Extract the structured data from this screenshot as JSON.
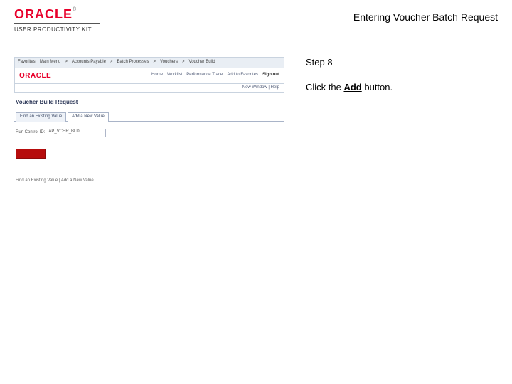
{
  "header": {
    "logo_text": "ORACLE",
    "tm": "®",
    "upk": "USER PRODUCTIVITY KIT",
    "title": "Entering Voucher Batch Request"
  },
  "instructions": {
    "step_label": "Step 8",
    "line1_pre": "Click the ",
    "line1_bold": "Add",
    "line1_post": " button."
  },
  "app": {
    "breadcrumb": [
      "Favorites",
      "Main Menu",
      "Accounts Payable",
      "Batch Processes",
      "Vouchers",
      "Voucher Build"
    ],
    "logo_text": "ORACLE",
    "tabs": [
      "Home",
      "Worklist",
      "Performance Trace",
      "Add to Favorites"
    ],
    "signout": "Sign out",
    "subline": "New Window | Help",
    "section_title": "Voucher Build Request",
    "tab_find": "Find an Existing Value",
    "tab_add": "Add a New Value",
    "criteria_label": "Run Control ID:",
    "criteria_value": "AP_VCHR_BLD",
    "footer": "Find an Existing Value | Add a New Value"
  }
}
